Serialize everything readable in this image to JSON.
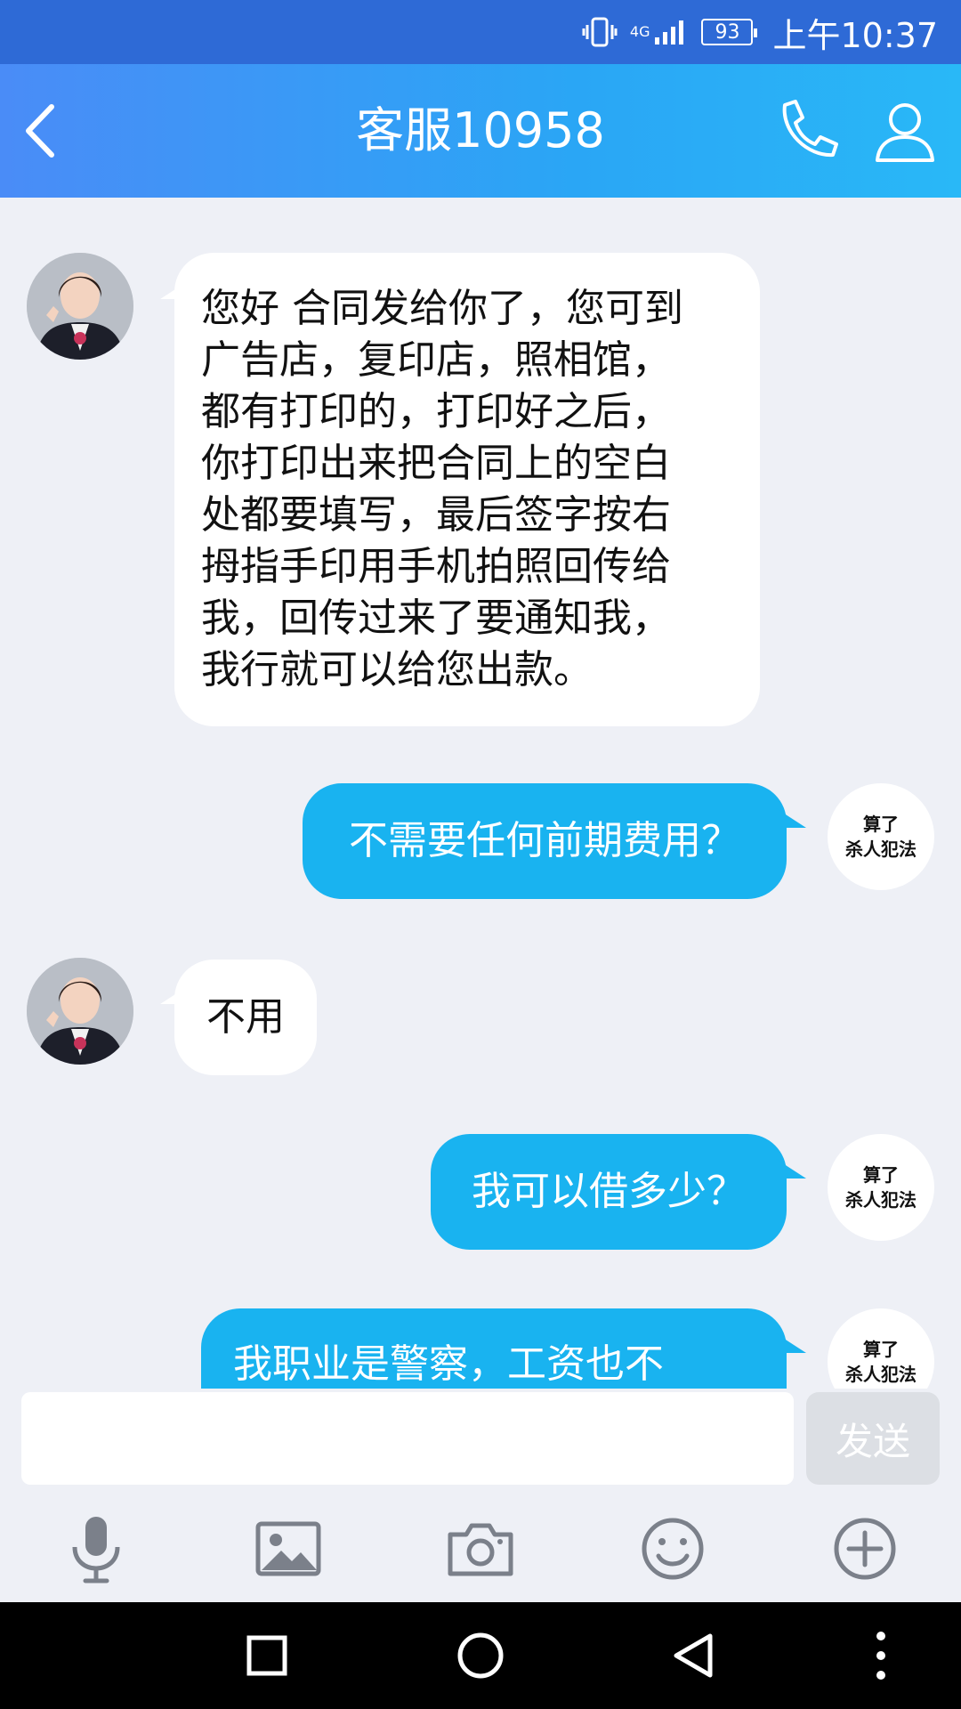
{
  "status_bar": {
    "network": "4G",
    "battery": "93",
    "time": "上午10:37"
  },
  "header": {
    "title": "客服10958",
    "back_icon": "chevron-left-icon",
    "call_icon": "phone-icon",
    "profile_icon": "person-icon"
  },
  "self_avatar_text": {
    "line1": "算了",
    "line2": "杀人犯法"
  },
  "messages": [
    {
      "from": "contact",
      "lines": [
        "您好 合同发给你了，您可到",
        "广告店，复印店，照相馆，",
        "都有打印的，打印好之后，",
        "你打印出来把合同上的空白",
        "处都要填写，最后签字按右",
        "拇指手印用手机拍照回传给",
        "我，回传过来了要通知我，",
        "我行就可以给您出款。"
      ]
    },
    {
      "from": "self",
      "text": "不需要任何前期费用？"
    },
    {
      "from": "contact",
      "text": "不用"
    },
    {
      "from": "self",
      "text": "我可以借多少？"
    },
    {
      "from": "self",
      "text": "我职业是警察，工资也不"
    }
  ],
  "input": {
    "value": "",
    "send_label": "发送"
  },
  "toolbar_icons": [
    "microphone-icon",
    "image-icon",
    "camera-icon",
    "emoji-icon",
    "plus-circle-icon"
  ],
  "nav_icons": [
    "recent-apps-icon",
    "home-icon",
    "back-icon",
    "more-icon"
  ],
  "colors": {
    "header_start": "#4a8cf7",
    "header_end": "#29b8f7",
    "out_bubble": "#19b3f0",
    "in_bubble": "#ffffff",
    "background": "#eef0f6"
  }
}
